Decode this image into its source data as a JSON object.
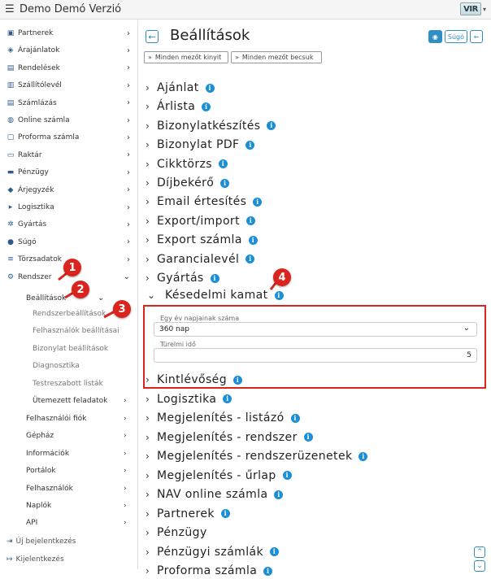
{
  "app": {
    "title": "Demo Demó Verzió",
    "menu_icon": "hamburger-icon",
    "logo_text": "VIR"
  },
  "sidebar": {
    "items": [
      {
        "label": "Partnerek",
        "icon": "address-card-icon"
      },
      {
        "label": "Árajánlatok",
        "icon": "handshake-icon"
      },
      {
        "label": "Rendelések",
        "icon": "file-icon"
      },
      {
        "label": "Szállítólevél",
        "icon": "clipboard-icon"
      },
      {
        "label": "Számlázás",
        "icon": "file-invoice-icon"
      },
      {
        "label": "Online számla",
        "icon": "globe-icon"
      },
      {
        "label": "Proforma számla",
        "icon": "file-alt-icon"
      },
      {
        "label": "Raktár",
        "icon": "warehouse-icon"
      },
      {
        "label": "Pénzügy",
        "icon": "money-icon"
      },
      {
        "label": "Árjegyzék",
        "icon": "tags-icon"
      },
      {
        "label": "Logisztika",
        "icon": "truck-icon"
      },
      {
        "label": "Gyártás",
        "icon": "cogs-icon"
      },
      {
        "label": "Súgó",
        "icon": "question-icon"
      },
      {
        "label": "Törzsadatok",
        "icon": "database-icon"
      },
      {
        "label": "Rendszer",
        "icon": "gears-icon"
      }
    ],
    "sub_beallitasok": "Beállítások",
    "sub_items": [
      "Rendszerbeállítások",
      "Felhasználók beállításai",
      "Bizonylat beállítások",
      "Diagnosztika",
      "Testreszabott listák",
      "Ütemezett feladatok"
    ],
    "sub_level1": [
      "Felhasználói fiók",
      "Gépház",
      "Információk",
      "Portálok",
      "Felhasználók",
      "Naplók",
      "API"
    ],
    "bottom": [
      {
        "label": "Új bejelentkezés",
        "icon": "sign-in-icon"
      },
      {
        "label": "Kijelentkezés",
        "icon": "sign-out-icon"
      }
    ]
  },
  "main": {
    "title": "Beállítások",
    "help_label": "Súgó",
    "expand_all": "Minden mezőt kinyit",
    "collapse_all": "Minden mezőt becsuk",
    "sections_before": [
      {
        "label": "Ajánlat",
        "info": true
      },
      {
        "label": "Árlista",
        "info": true
      },
      {
        "label": "Bizonylatkészítés",
        "info": true
      },
      {
        "label": "Bizonylat PDF",
        "info": true
      },
      {
        "label": "Cikktörzs",
        "info": true
      },
      {
        "label": "Díjbekérő",
        "info": true
      },
      {
        "label": "Email értesítés",
        "info": true
      },
      {
        "label": "Export/import",
        "info": true
      },
      {
        "label": "Export számla",
        "info": true
      },
      {
        "label": "Garancialevél",
        "info": true
      },
      {
        "label": "Gyártás",
        "info": true
      }
    ],
    "open_section": {
      "label": "Késedelmi kamat",
      "fields": {
        "year_days_label": "Egy év napjainak száma",
        "year_days_value": "360 nap",
        "tolerance_label": "Türelmi idő",
        "tolerance_value": "5"
      }
    },
    "sections_after": [
      {
        "label": "Kintlévőség",
        "info": true
      },
      {
        "label": "Logisztika",
        "info": true
      },
      {
        "label": "Megjelenítés - listázó",
        "info": true
      },
      {
        "label": "Megjelenítés - rendszer",
        "info": true
      },
      {
        "label": "Megjelenítés - rendszerüzenetek",
        "info": true
      },
      {
        "label": "Megjelenítés - űrlap",
        "info": true
      },
      {
        "label": "NAV online számla",
        "info": true
      },
      {
        "label": "Partnerek",
        "info": true
      },
      {
        "label": "Pénzügy",
        "info": false
      },
      {
        "label": "Pénzügyi számlák",
        "info": true
      },
      {
        "label": "Proforma számla",
        "info": true
      }
    ]
  },
  "annotations": [
    "1",
    "2",
    "3",
    "4"
  ],
  "colors": {
    "accent": "#2d8fc4",
    "annotation_red": "#d9251d",
    "info_blue": "#1a8fd6"
  }
}
